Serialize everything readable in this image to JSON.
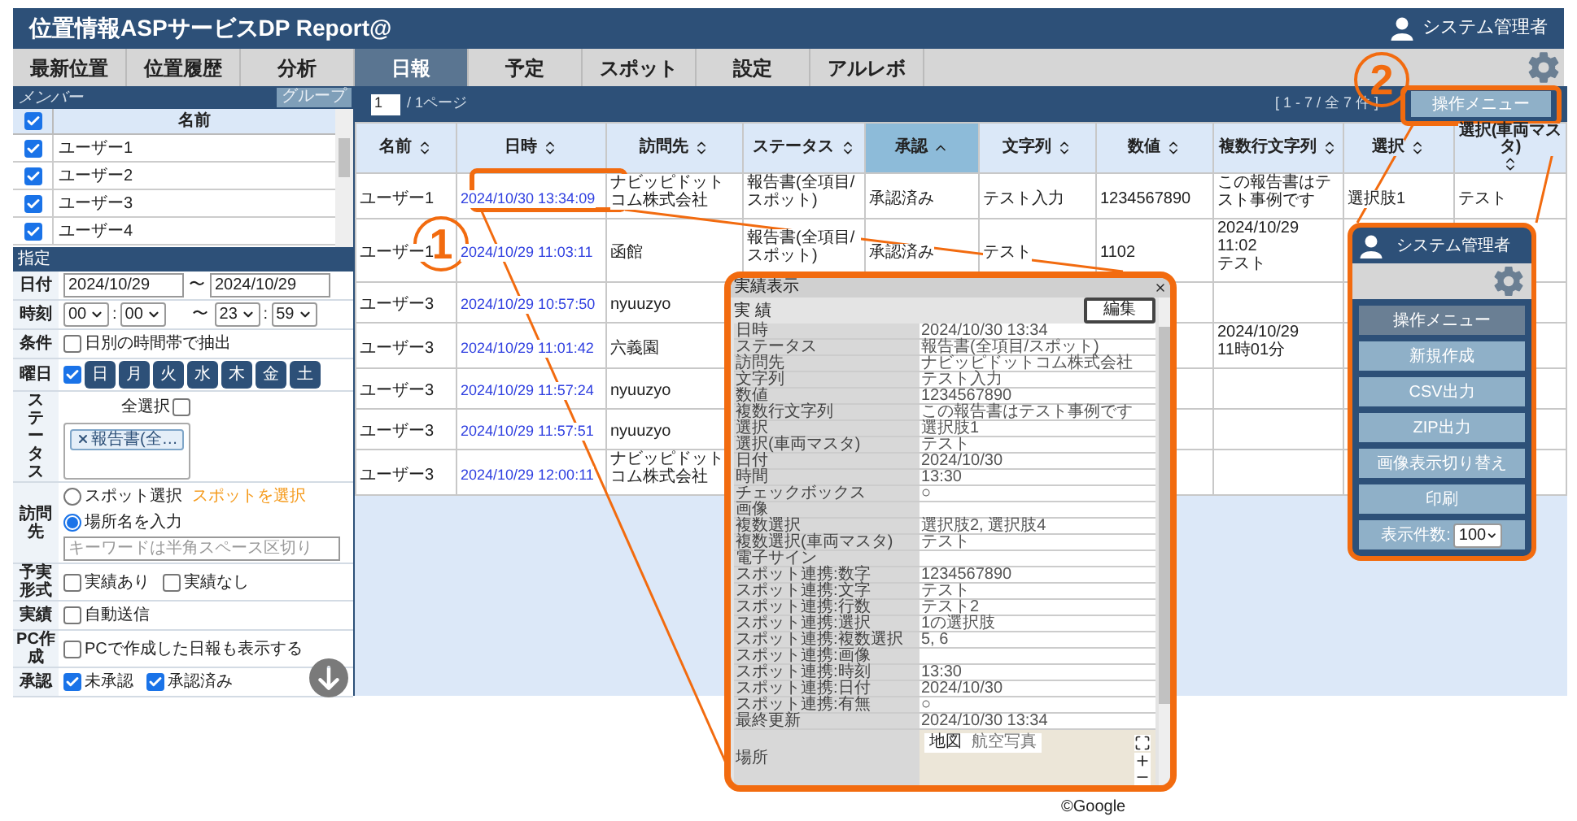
{
  "header": {
    "title": "位置情報ASPサービスDP Report@",
    "user": "システム管理者"
  },
  "nav": {
    "left_tabs": [
      {
        "label": "最新位置",
        "selected": false
      },
      {
        "label": "位置履歴",
        "selected": false
      },
      {
        "label": "分析",
        "selected": false
      }
    ],
    "tabs": [
      {
        "label": "日報",
        "selected": true
      },
      {
        "label": "予定",
        "selected": false
      },
      {
        "label": "スポット",
        "selected": false
      },
      {
        "label": "設定",
        "selected": false
      },
      {
        "label": "アルレボ",
        "selected": false
      }
    ]
  },
  "members": {
    "title": "メンバー",
    "group_button": "グループ",
    "column": "名前",
    "all_checked": true,
    "rows": [
      {
        "name": "ユーザー1",
        "checked": true
      },
      {
        "name": "ユーザー2",
        "checked": true
      },
      {
        "name": "ユーザー3",
        "checked": true
      },
      {
        "name": "ユーザー4",
        "checked": true
      }
    ]
  },
  "filters": {
    "title": "指定",
    "rows": [
      {
        "kind": "date",
        "label": "日付",
        "from": "2024/10/29",
        "separator": "〜",
        "to": "2024/10/29"
      },
      {
        "kind": "time",
        "label": "時刻",
        "from": {
          "hour": "00",
          "colon": ":",
          "minute": "00"
        },
        "separator": "〜",
        "to": {
          "hour": "23",
          "colon": ":",
          "minute": "59"
        }
      },
      {
        "kind": "checks",
        "label": "条件",
        "options": [
          {
            "label": "日別の時間帯で抽出",
            "checked": false
          }
        ]
      },
      {
        "kind": "weekday",
        "label": "曜日",
        "checked": true,
        "days": [
          {
            "label": "日",
            "selected": true
          },
          {
            "label": "月",
            "selected": true
          },
          {
            "label": "火",
            "selected": true
          },
          {
            "label": "水",
            "selected": true
          },
          {
            "label": "木",
            "selected": true
          },
          {
            "label": "金",
            "selected": true
          },
          {
            "label": "土",
            "selected": true
          }
        ]
      },
      {
        "kind": "status",
        "label": "ステータス",
        "select_all": {
          "label": "全選択",
          "checked": false
        },
        "tags": [
          {
            "label": "報告書(全…"
          }
        ]
      },
      {
        "kind": "visit",
        "label": "訪問先",
        "options": [
          {
            "label": "スポット選択",
            "selected": false
          },
          {
            "label": "場所名を入力",
            "selected": true
          }
        ],
        "spot_link": "スポットを選択",
        "placeholder": "キーワードは半角スペース区切り"
      },
      {
        "kind": "checks",
        "label": "予実形式",
        "options": [
          {
            "label": "実績あり",
            "checked": false
          },
          {
            "label": "実績なし",
            "checked": false
          }
        ]
      },
      {
        "kind": "checks",
        "label": "実績",
        "options": [
          {
            "label": "自動送信",
            "checked": false
          }
        ]
      },
      {
        "kind": "checks",
        "label": "PC作成",
        "options": [
          {
            "label": "PCで作成した日報も表示する",
            "checked": false
          }
        ]
      },
      {
        "kind": "checks",
        "label": "承認",
        "options": [
          {
            "label": "未承認",
            "checked": true
          },
          {
            "label": "承認済み",
            "checked": true
          }
        ]
      }
    ]
  },
  "toolbar": {
    "page": "1",
    "page_total": "/ 1ページ",
    "range": "[ 1 - 7 / 全 7 件 ]",
    "menu_button": "操作メニュー"
  },
  "table": {
    "columns": [
      {
        "label": "名前",
        "sorted": false,
        "kind": "text"
      },
      {
        "label": "日時",
        "sorted": false,
        "kind": "link"
      },
      {
        "label": "訪問先",
        "sorted": false,
        "kind": "text"
      },
      {
        "label": "ステータス",
        "sorted": false,
        "kind": "text"
      },
      {
        "label": "承認",
        "sorted": true,
        "kind": "text"
      },
      {
        "label": "文字列",
        "sorted": false,
        "kind": "text"
      },
      {
        "label": "数値",
        "sorted": false,
        "kind": "text"
      },
      {
        "label": "複数行文字列",
        "sorted": false,
        "kind": "text"
      },
      {
        "label": "選択",
        "sorted": false,
        "kind": "text"
      },
      {
        "label": "選択(車両マスタ)",
        "sorted": false,
        "kind": "text"
      }
    ],
    "rows": [
      {
        "cells": [
          "ユーザー1",
          "2024/10/30 13:34:09",
          "ナビッピドットコム株式会社",
          "報告書(全項目/スポット)",
          "承認済み",
          "テスト入力",
          "1234567890",
          "この報告書はテスト事例です",
          "選択肢1",
          "テスト"
        ]
      },
      {
        "cells": [
          "ユーザー1",
          "2024/10/29 11:03:11",
          "函館",
          "報告書(全項目/スポット)",
          "承認済み",
          "テスト",
          "1102",
          "2024/10/29\n11:02\nテスト",
          null,
          null
        ]
      },
      {
        "cells": [
          "ユーザー3",
          "2024/10/29 10:57:50",
          "nyuuzyo",
          null,
          null,
          null,
          null,
          null,
          null,
          null
        ]
      },
      {
        "cells": [
          "ユーザー3",
          "2024/10/29 11:01:42",
          "六義園",
          null,
          null,
          null,
          null,
          "2024/10/29\n11時01分",
          null,
          null
        ]
      },
      {
        "cells": [
          "ユーザー3",
          "2024/10/29 11:57:24",
          "nyuuzyo",
          null,
          null,
          null,
          null,
          null,
          null,
          null
        ]
      },
      {
        "cells": [
          "ユーザー3",
          "2024/10/29 11:57:51",
          "nyuuzyo",
          null,
          null,
          null,
          null,
          null,
          null,
          null
        ]
      },
      {
        "cells": [
          "ユーザー3",
          "2024/10/29 12:00:11",
          "ナビッピドットコム株式会社",
          null,
          null,
          null,
          null,
          null,
          null,
          null
        ]
      }
    ]
  },
  "detail": {
    "window_title": "実績表示",
    "heading": "実 績",
    "edit_button": "編集",
    "fields": [
      {
        "label": "日時",
        "value": "2024/10/30 13:34"
      },
      {
        "label": "ステータス",
        "value": "報告書(全項目/スポット)"
      },
      {
        "label": "訪問先",
        "value": "ナビッピドットコム株式会社"
      },
      {
        "label": "文字列",
        "value": "テスト入力"
      },
      {
        "label": "数値",
        "value": "1234567890"
      },
      {
        "label": "複数行文字列",
        "value": "この報告書はテスト事例です"
      },
      {
        "label": "選択",
        "value": "選択肢1"
      },
      {
        "label": "選択(車両マスタ)",
        "value": "テスト"
      },
      {
        "label": "日付",
        "value": "2024/10/30"
      },
      {
        "label": "時間",
        "value": "13:30"
      },
      {
        "label": "チェックボックス",
        "value": "○"
      },
      {
        "label": "画像"
      },
      {
        "label": "複数選択",
        "value": "選択肢2, 選択肢4"
      },
      {
        "label": "複数選択(車両マスタ)",
        "value": "テスト"
      },
      {
        "label": "電子サイン"
      },
      {
        "label": "スポット連携:数字",
        "value": "1234567890"
      },
      {
        "label": "スポット連携:文字",
        "value": "テスト"
      },
      {
        "label": "スポット連携:行数",
        "value": "テスト2"
      },
      {
        "label": "スポット連携:選択",
        "value": "1の選択肢"
      },
      {
        "label": "スポット連携:複数選択",
        "value": "5, 6"
      },
      {
        "label": "スポット連携:画像"
      },
      {
        "label": "スポット連携:時刻",
        "value": "13:30"
      },
      {
        "label": "スポット連携:日付",
        "value": "2024/10/30"
      },
      {
        "label": "スポット連携:有無",
        "value": "○"
      },
      {
        "label": "最終更新",
        "value": "2024/10/30 13:34"
      }
    ],
    "location": {
      "label": "場所",
      "map_types": [
        {
          "label": "地図",
          "selected": true
        },
        {
          "label": "航空写真",
          "selected": false
        }
      ]
    },
    "credit": "©Google"
  },
  "menu": {
    "user": "システム管理者",
    "items": [
      {
        "label": "操作メニュー",
        "kind": "header"
      },
      {
        "label": "新規作成",
        "kind": "button"
      },
      {
        "label": "CSV出力",
        "kind": "button"
      },
      {
        "label": "ZIP出力",
        "kind": "button"
      },
      {
        "label": "画像表示切り替え",
        "kind": "button"
      },
      {
        "label": "印刷",
        "kind": "button"
      },
      {
        "label": "表示件数:",
        "kind": "select",
        "value": "100"
      }
    ]
  },
  "callouts": [
    {
      "label": "1"
    },
    {
      "label": "2"
    }
  ]
}
